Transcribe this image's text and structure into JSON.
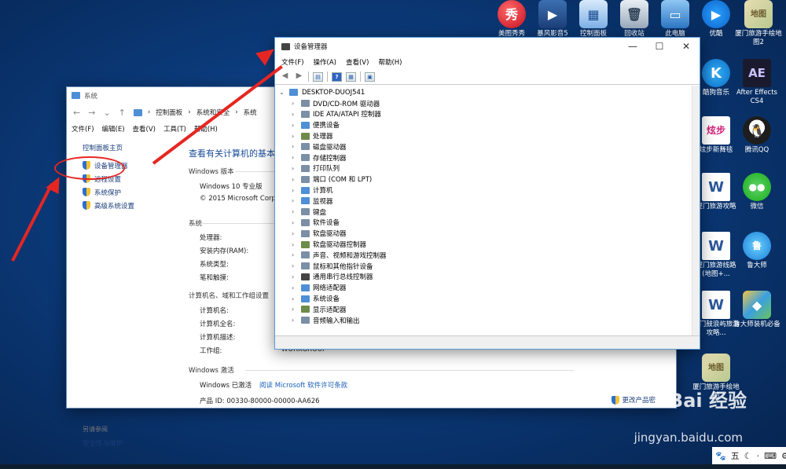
{
  "desktop": {
    "top_icons": [
      {
        "label": "美图秀秀",
        "glyph": "秀"
      },
      {
        "label": "暴风影音5",
        "glyph": "▶"
      },
      {
        "label": "控制面板",
        "glyph": "▦"
      },
      {
        "label": "回收站",
        "glyph": "🗑"
      },
      {
        "label": "此电脑",
        "glyph": "▭"
      },
      {
        "label": "优酷",
        "glyph": "▶"
      },
      {
        "label": "厦门旅游手绘地图2",
        "glyph": "地图"
      }
    ],
    "right_icons": [
      {
        "label": "酷狗音乐",
        "glyph": "K"
      },
      {
        "label": "After Effects CS4",
        "glyph": "AE"
      },
      {
        "label": "炫步新舞毯",
        "glyph": "炫步"
      },
      {
        "label": "腾讯QQ",
        "glyph": "🐧"
      },
      {
        "label": "厦门旅游攻略",
        "glyph": "W"
      },
      {
        "label": "微信",
        "glyph": "●●"
      },
      {
        "label": "厦门旅游线路(地图+...",
        "glyph": "W"
      },
      {
        "label": "鲁大师",
        "glyph": "鲁"
      },
      {
        "label": "厦门鼓浪屿旅游攻略...",
        "glyph": "W"
      },
      {
        "label": "鲁大师装机必备",
        "glyph": "◆"
      },
      {
        "label": "厦门旅游手绘地图",
        "glyph": "地图"
      }
    ]
  },
  "system_window": {
    "title": "系统",
    "breadcrumbs": [
      "控制面板",
      "系统和安全",
      "系统"
    ],
    "menu": [
      "文件(F)",
      "编辑(E)",
      "查看(V)",
      "工具(T)",
      "帮助(H)"
    ],
    "sidebar": {
      "home": "控制面板主页",
      "items": [
        "设备管理器",
        "远程设置",
        "系统保护",
        "高级系统设置"
      ],
      "see_also": "另请参阅",
      "security": "安全性与维护"
    },
    "heading": "查看有关计算机的基本",
    "edition_title": "Windows 版本",
    "edition": "Windows 10 专业版",
    "copyright": "© 2015 Microsoft Corpo",
    "system_title": "系统",
    "system_rows": [
      "处理器:",
      "安装内存(RAM):",
      "系统类型:",
      "笔和触摸:"
    ],
    "computer_title": "计算机名、域和工作组设置",
    "computer_rows": [
      "计算机名:",
      "计算机全名:",
      "计算机描述:",
      "工作组:"
    ],
    "workgroup_value": "WORKGROUP",
    "activation_title": "Windows 激活",
    "activated": "Windows 已激活",
    "license_link": "阅读 Microsoft 软件许可条款",
    "product_id": "产品 ID: 00330-80000-00000-AA626",
    "change_key": "更改产品密"
  },
  "device_manager": {
    "title": "设备管理器",
    "menu": [
      "文件(F)",
      "操作(A)",
      "查看(V)",
      "帮助(H)"
    ],
    "root": "DESKTOP-DUOJ541",
    "nodes": [
      "DVD/CD-ROM 驱动器",
      "IDE ATA/ATAPI 控制器",
      "便携设备",
      "处理器",
      "磁盘驱动器",
      "存储控制器",
      "打印队列",
      "端口 (COM 和 LPT)",
      "计算机",
      "监视器",
      "键盘",
      "软件设备",
      "软盘驱动器",
      "软盘驱动器控制器",
      "声音、视频和游戏控制器",
      "鼠标和其他指针设备",
      "通用串行总线控制器",
      "网络适配器",
      "系统设备",
      "显示适配器",
      "音频输入和输出"
    ]
  },
  "watermark": {
    "logo": "Bai 经验",
    "url": "jingyan.baidu.com"
  },
  "tray": {
    "ime": "五"
  }
}
